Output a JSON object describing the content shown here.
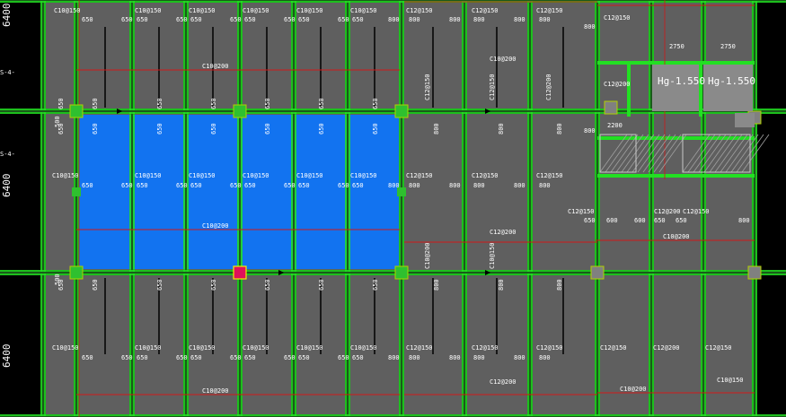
{
  "drawing": {
    "left_dims": [
      "6400",
      "6400",
      "6400"
    ],
    "axis_labels": [
      "S-4-",
      "S-4-"
    ],
    "elevation_tags": [
      "Hg-1.550",
      "Hg-1.550"
    ],
    "row1_rebar": [
      "C10@150",
      "C10@150",
      "C10@150",
      "C10@150",
      "C10@150",
      "C10@150",
      "C12@150",
      "C12@150",
      "C12@150"
    ],
    "row1_dims": [
      "650",
      "650",
      "650",
      "650",
      "650",
      "650",
      "650",
      "650",
      "650",
      "650",
      "650",
      "800",
      "800",
      "800",
      "800",
      "800",
      "800"
    ],
    "row1_span": [
      "C10@200",
      "C10@200"
    ],
    "row2_rebar": [
      "C10@150",
      "C10@150",
      "C10@150",
      "C10@150",
      "C10@150",
      "C10@150",
      "C12@150",
      "C12@150",
      "C12@150"
    ],
    "row2_span": [
      "C10@200",
      "C12@200"
    ],
    "row3_rebar": [
      "C10@150",
      "C10@150",
      "C10@150",
      "C10@150",
      "C10@150",
      "C10@150",
      "C12@150",
      "C12@150",
      "C12@150",
      "C12@150",
      "C12@200",
      "C12@150"
    ],
    "row3_span": [
      "C10@200",
      "C12@200",
      "C10@200"
    ],
    "vertical_rebar": [
      "C12@150",
      "C12@150",
      "C12@200",
      "C10@200",
      "C10@150",
      "C12@150",
      "C12@200",
      "C12@150",
      "C12@150",
      "C12@200"
    ],
    "right_labels": [
      "C12@150",
      "C12@200",
      "C12@150",
      "C12@200",
      "C12@150",
      "C10@200",
      "C10@150"
    ],
    "right_dims": [
      "800",
      "800",
      "2750",
      "2750",
      "2200",
      "650",
      "600",
      "600",
      "650",
      "650",
      "800",
      "650"
    ],
    "beam_dims": [
      "500",
      "650",
      "650",
      "650",
      "650",
      "650",
      "650",
      "800",
      "800",
      "800",
      "650",
      "650",
      "650",
      "800",
      "800"
    ],
    "colors": {
      "background": "#000000",
      "slab": "#5f5f5f",
      "beam_edge": "#22e022",
      "highlight": "#1273f0",
      "column": "#2fc02f",
      "column_gray": "#808080",
      "selected_column": "#e0105a",
      "red_line": "#d01818",
      "dim_orange": "#e0a020",
      "text": "#ffffff"
    }
  }
}
